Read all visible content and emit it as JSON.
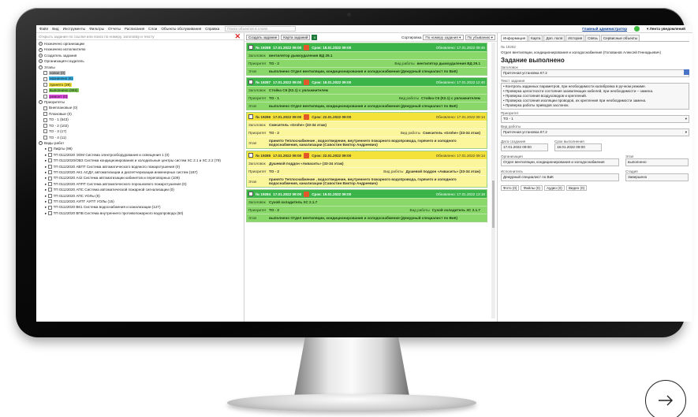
{
  "menu": {
    "items": [
      "Файл",
      "Вид",
      "Инструменты",
      "Фильтры",
      "Отчеты",
      "Расписания",
      "Слои",
      "Объекты обслуживания",
      "Справка"
    ],
    "search_placeholder": "Поиск объектов в слоях",
    "admin": "Главный администратор",
    "feed": "▾ Лента уведомлений"
  },
  "left": {
    "search_placeholder": "Открыть задание по ссылке или поиск по номеру, заголовку и тексту",
    "groups": [
      "Назначено организации",
      "Назначено исполнителю",
      "Создатель задания",
      "Организация-создатель",
      "Этапы"
    ],
    "stages": [
      {
        "label": "новое (0)",
        "bg": "#bfbfbf"
      },
      {
        "label": "назначено (6)",
        "bg": "#39b2e6"
      },
      {
        "label": "принято (39)",
        "bg": "#f4e23a"
      },
      {
        "label": "выполнено (658)",
        "bg": "#7ccd4d"
      },
      {
        "label": "ремонт (0)",
        "bg": "#e04be0"
      }
    ],
    "priorities_title": "Приоритеты",
    "priorities": [
      "Внеплановые (0)",
      "Плановые (0)",
      "ТО - 1 (543)",
      "ТО - 2 (102)",
      "ТО - 3 (17)",
      "ТО - 4 (11)"
    ],
    "works_title": "Виды работ",
    "works": [
      "Лифты (98)",
      "ТП 01122020 ЭОМ Система электрооборудования и освещения 1 (0)",
      "ТП 01122020/ОВ3 Система кондиционирования и холодильные центры систем ХС 2.1 и ХС 2.2 (79)",
      "ТП 01122020 АВПТ Система автоматического водяного пожаротушения (0)",
      "ТП 01122020 АК1 АСДУ, автоматизации и диспетчеризации инженерных систем (187)",
      "ТП 01122020 А42 Система автоматизации кабинетов и переговорных (109)",
      "ТП 01122020 АППТ Система автоматического порошкового пожаротушения (0)",
      "ТП 01122020 АПС Система автоматической пожарной сигнализации (0)",
      "ТП 01122020 АПС УОЛы (8)",
      "ТП 01122020 АУПТ АУПТ УОЛы (15)",
      "ТП 01122020 ВК1 Система водоснабжения и канализации (127)",
      "ТП 01122020 ВПВ Система внутреннего противопожарного водопровода (50)"
    ]
  },
  "mid": {
    "create_btn": "Создать задание",
    "map_btn": "Карта заданий",
    "xls": "X",
    "sort_label": "Сортировка",
    "sort_field": "По номеру задания",
    "sort_order": "По убыванию",
    "labels": {
      "title": "Заголовок",
      "priority": "Приоритет",
      "stage": "Этап",
      "kind": "Вид работы"
    },
    "cards": [
      {
        "color": "g",
        "num": "№ 19288",
        "date": "17.01.2022 09:00",
        "deadline": "Срок: 18.01.2022 09:00",
        "updated": "Обновлено: 17.01.2022 09:46",
        "title": "вентилятор дымоудаления ВД 29.1",
        "priority": "ТО - 2",
        "kind": "вентилятор дымоудаления ВД 29.1",
        "stage": "выполнено Отдел вентиляции, кондиционирования и холодоснабжения (Дежурный специалист по ВиК)"
      },
      {
        "color": "g",
        "num": "№ 19287",
        "date": "17.01.2022 09:00",
        "deadline": "Срок: 18.01.2022 09:00",
        "updated": "Обновлено: 17.01.2022 12:40",
        "title": "Стойка С6 (К2.1) с увлажнителем",
        "priority": "ТО - 1",
        "kind": "Стойка С6 (К2.1) с увлажнителем",
        "stage": "выполнено Отдел вентиляции, кондиционирования и холодоснабжения (Дежурный специалист по ВиК)"
      },
      {
        "color": "y",
        "num": "№ 19286",
        "date": "17.01.2022 09:00",
        "deadline": "Срок: 22.01.2022 09:00",
        "updated": "Обновлено: 17.01.2022 09:14",
        "title": "Смеситель «Grohe» (33-34 этаж)",
        "priority": "ТО - 2",
        "kind": "Смеситель «Grohe» (33-34 этаж)",
        "stage": "принято Теплоснабжение , водоотведение, внутреннего пожарного водопровода, горячего и холодного водоснабжения, канализации (Савостин Виктор Андреевич)"
      },
      {
        "color": "y",
        "num": "№ 19285",
        "date": "17.01.2022 09:00",
        "deadline": "Срок: 22.01.2022 09:00",
        "updated": "Обновлено: 17.01.2022 09:14",
        "title": "Душевой поддон «Аквасить» (33-34 этаж)",
        "priority": "ТО - 2",
        "kind": "Душевой поддон «Аквасить» (33-34 этаж)",
        "stage": "принято Теплоснабжение , водоотведение, внутреннего пожарного водопровода, горячего и холодного водоснабжения, канализации (Савостин Виктор Андреевич)"
      },
      {
        "color": "g",
        "num": "№ 19284",
        "date": "17.01.2022 09:00",
        "deadline": "Срок: 19.01.2022 09:00",
        "updated": "Обновлено: 17.01.2022 13:18",
        "title": "Сухой охладитель ХС 2.1.7",
        "priority": "ТО - 2",
        "kind": "Сухой охладитель ХС 2.1.7",
        "stage": "выполнено Отдел вентиляции, кондиционирования и холодоснабжения (Дежурный специалист по ВиК)"
      }
    ]
  },
  "right": {
    "tabs": [
      "Информация",
      "Карта",
      "Доп. поля",
      "История",
      "Связь",
      "Сервисные объекты"
    ],
    "id": "№ 19282",
    "org": "Отдел вентиляции, кондиционирования и холодоснабжения (Голованов Алексей Геннадьевич)",
    "status": "Задание выполнено",
    "title_lbl": "Заголовок",
    "title_val": "Приточная установка К7.2",
    "text_lbl": "Текст задания",
    "text_lines": [
      "• Контроль заданных параметров, при необходимости калибровка в ручном режиме.",
      "• Проверка целостности состояния заземляющих кабелей, при необходимости – замена.",
      "• Проверка состояния воздуховодов и креплений.",
      "• Проверка состояния изоляции проводов, их крепления при необходимости замена.",
      "• Проверка работы приводов заслонок."
    ],
    "priority_lbl": "Приоритет",
    "priority_val": "ТО - 1",
    "kind_lbl": "Вид работы",
    "kind_val": "Приточная установка К7.2",
    "created_lbl": "Дата создания",
    "created_val": "17.01.2022 09:00",
    "due_lbl": "Срок выполнения",
    "due_val": "18.01.2022 09:00",
    "org_lbl": "Организация",
    "org_val": "Отдел вентиляции, кондиционирования и холодоснабжения",
    "stage_lbl": "Этап",
    "stage_val": "выполнено",
    "exec_lbl": "Исполнитель",
    "exec_val": "Дежурный специалист по ВиК",
    "st_lbl": "Стадия",
    "st_val": "Завершено",
    "media": [
      "Фото (0)",
      "Файлы (0)",
      "Аудио (0)",
      "Видео (0)"
    ]
  }
}
